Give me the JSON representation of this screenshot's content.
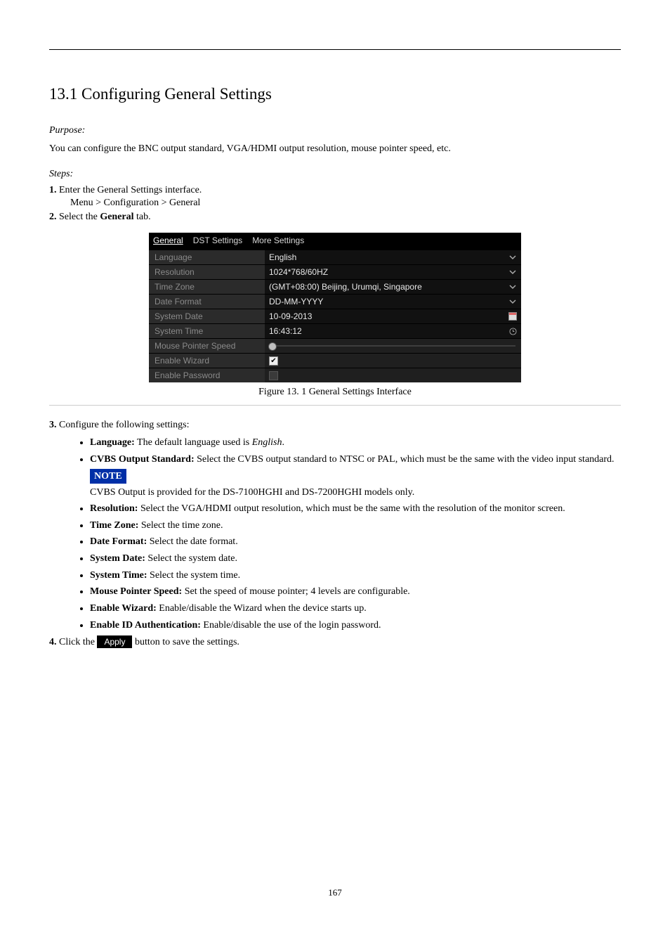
{
  "heading": "13.1 Configuring General Settings",
  "purpose_label": "Purpose:",
  "purpose_body": "You can configure the BNC output standard, VGA/HDMI output resolution, mouse pointer speed, etc.",
  "steps_label": "Steps:",
  "step1_text": "Enter the General Settings interface.",
  "step1_path": "Menu > Configuration > General",
  "step2_text": "Select the General tab.",
  "step1_num": "1.",
  "step2_num": "2.",
  "ui": {
    "tabs": {
      "general": "General",
      "dst": "DST Settings",
      "more": "More Settings"
    },
    "rows": {
      "language_lbl": "Language",
      "language_val": "English",
      "resolution_lbl": "Resolution",
      "resolution_val": "1024*768/60HZ",
      "timezone_lbl": "Time Zone",
      "timezone_val": "(GMT+08:00) Beijing, Urumqi, Singapore",
      "dateformat_lbl": "Date Format",
      "dateformat_val": "DD-MM-YYYY",
      "sysdate_lbl": "System Date",
      "sysdate_val": "10-09-2013",
      "systime_lbl": "System Time",
      "systime_val": "16:43:12",
      "mouse_lbl": "Mouse Pointer Speed",
      "wizard_lbl": "Enable Wizard",
      "password_lbl": "Enable Password"
    }
  },
  "fig_caption": "Figure 13. 1 General Settings Interface",
  "cfg_intro_num": "3.",
  "cfg_intro": "Configure the following settings:",
  "bullets": {
    "lang": "Language: The default language used is English.",
    "cvbs": "CVBS Output Standard: Select the CVBS output standard to NTSC or PAL, which must be the same with the video input standard.",
    "note_lbl": "NOTE",
    "note_body": "CVBS Output is provided for the DS-7100HGHI and DS-7200HGHI models only.",
    "res": "Resolution: Select the VGA/HDMI output resolution, which must be the same with the resolution of the monitor screen.",
    "tz": "Time Zone: Select the time zone.",
    "df": "Date Format: Select the date format.",
    "sd": "System Date: Select the system date.",
    "st": "System Time: Select the system time.",
    "mp": "Mouse Pointer Speed: Set the speed of mouse pointer; 4 levels are configurable.",
    "ew": "Enable Wizard: Enable/disable the Wizard when the device starts up.",
    "ep_pre": "Enable ID Authentication: Enable/disable the use of the login password.",
    "apply_pre": "Click the ",
    "apply_btn": "Apply",
    "apply_post": " button to save the settings."
  },
  "step4_num": "4.",
  "page_number": "167"
}
